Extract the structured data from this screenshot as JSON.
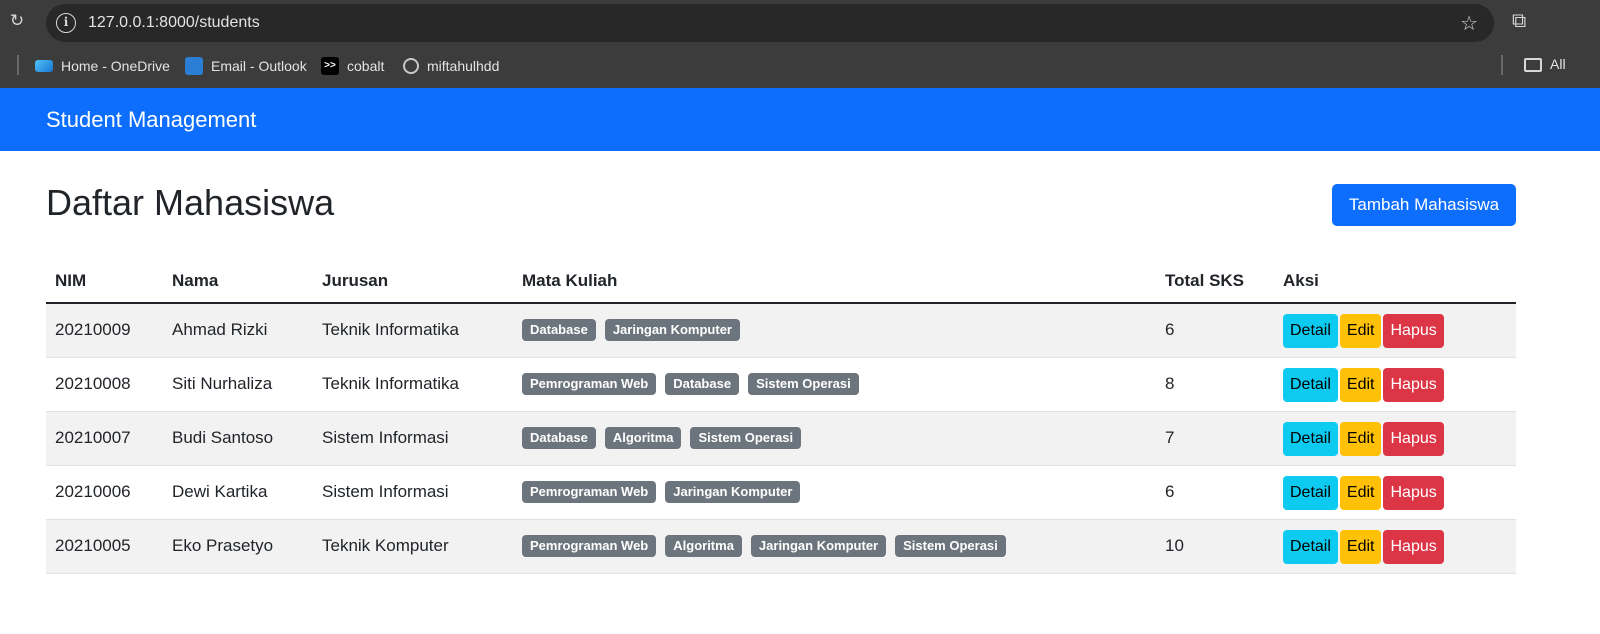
{
  "browser": {
    "url": "127.0.0.1:8000/students",
    "bookmarks": [
      {
        "label": "Home - OneDrive",
        "icon": "onedrive-icon"
      },
      {
        "label": "Email - Outlook",
        "icon": "outlook-icon"
      },
      {
        "label": "cobalt",
        "icon": "cobalt-icon"
      },
      {
        "label": "miftahulhdd",
        "icon": "globe-icon"
      }
    ],
    "all_bookmarks_label": "All"
  },
  "navbar": {
    "brand": "Student Management",
    "color": "#0d6efd"
  },
  "page": {
    "title": "Daftar Mahasiswa",
    "add_button": "Tambah Mahasiswa"
  },
  "table": {
    "headers": [
      "NIM",
      "Nama",
      "Jurusan",
      "Mata Kuliah",
      "Total SKS",
      "Aksi"
    ],
    "actions": {
      "detail": "Detail",
      "edit": "Edit",
      "hapus": "Hapus"
    },
    "rows": [
      {
        "nim": "20210009",
        "nama": "Ahmad Rizki",
        "jurusan": "Teknik Informatika",
        "mata_kuliah": [
          "Database",
          "Jaringan Komputer"
        ],
        "sks": "6"
      },
      {
        "nim": "20210008",
        "nama": "Siti Nurhaliza",
        "jurusan": "Teknik Informatika",
        "mata_kuliah": [
          "Pemrograman Web",
          "Database",
          "Sistem Operasi"
        ],
        "sks": "8"
      },
      {
        "nim": "20210007",
        "nama": "Budi Santoso",
        "jurusan": "Sistem Informasi",
        "mata_kuliah": [
          "Database",
          "Algoritma",
          "Sistem Operasi"
        ],
        "sks": "7"
      },
      {
        "nim": "20210006",
        "nama": "Dewi Kartika",
        "jurusan": "Sistem Informasi",
        "mata_kuliah": [
          "Pemrograman Web",
          "Jaringan Komputer"
        ],
        "sks": "6"
      },
      {
        "nim": "20210005",
        "nama": "Eko Prasetyo",
        "jurusan": "Teknik Komputer",
        "mata_kuliah": [
          "Pemrograman Web",
          "Algoritma",
          "Jaringan Komputer",
          "Sistem Operasi"
        ],
        "sks": "10"
      }
    ]
  }
}
